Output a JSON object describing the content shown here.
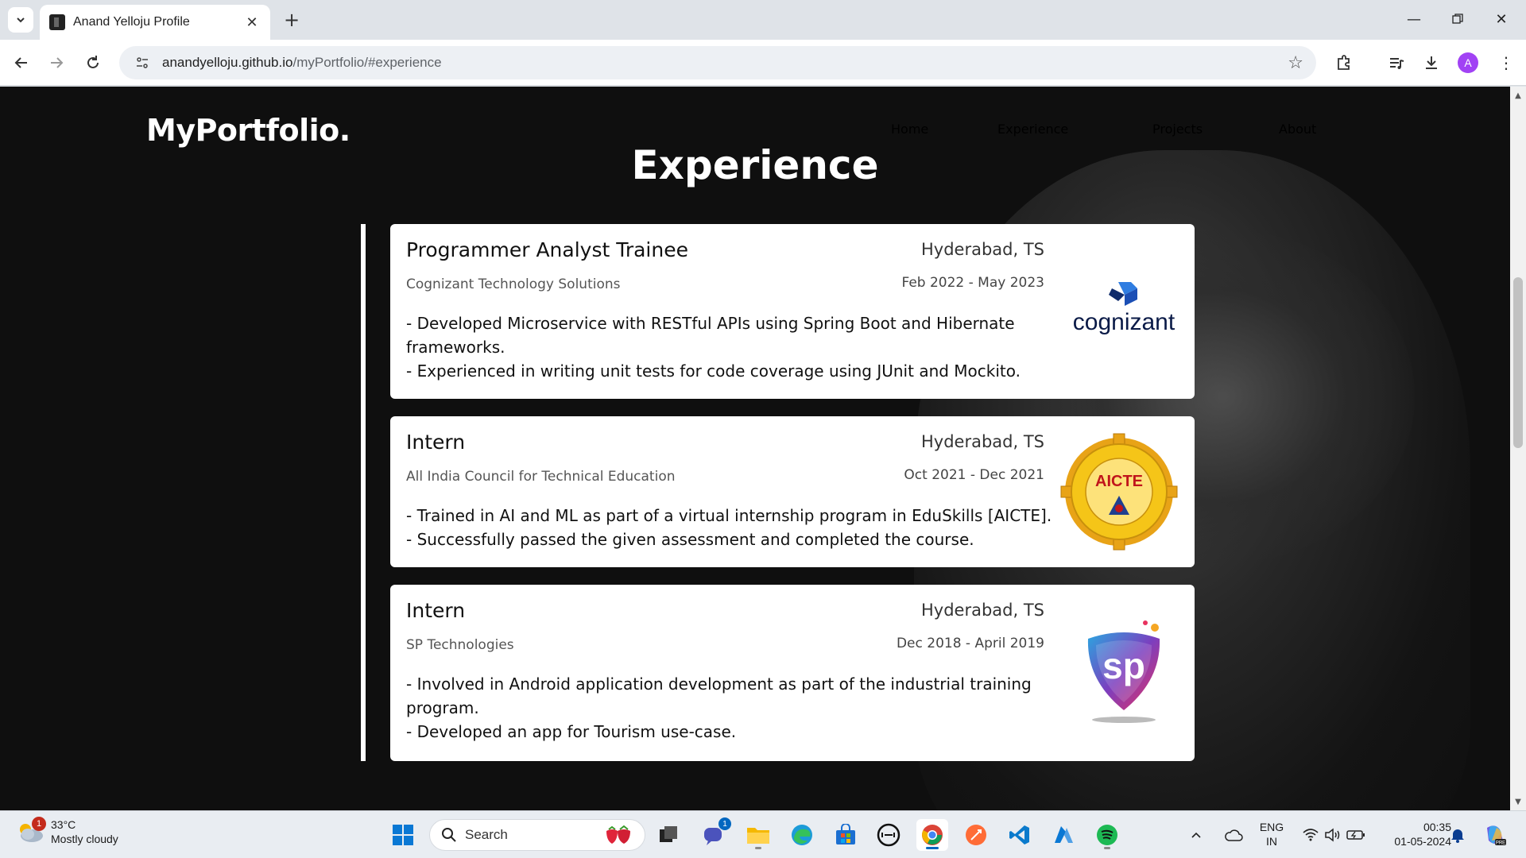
{
  "browser": {
    "tab_title": "Anand Yelloju Profile",
    "url_host": "anandyelloju.github.io",
    "url_path": "/myPortfolio/#experience",
    "profile_initial": "A"
  },
  "site": {
    "logo": "MyPortfolio.",
    "nav": [
      "Home",
      "Experience",
      "Projects",
      "About"
    ],
    "section_title": "Experience"
  },
  "experiences": [
    {
      "role": "Programmer Analyst Trainee",
      "location": "Hyderabad, TS",
      "company": "Cognizant Technology Solutions",
      "dates": "Feb 2022 - May 2023",
      "desc": [
        "- Developed Microservice with RESTful APIs using Spring Boot and Hibernate frameworks.",
        "- Experienced in writing unit tests for code coverage using JUnit and Mockito."
      ],
      "logo": "cognizant"
    },
    {
      "role": "Intern",
      "location": "Hyderabad, TS",
      "company": "All India Council for Technical Education",
      "dates": "Oct 2021 - Dec 2021",
      "desc": [
        "- Trained in AI and ML as part of a virtual internship program in EduSkills [AICTE].",
        "- Successfully passed the given assessment and completed the course."
      ],
      "logo": "AICTE"
    },
    {
      "role": "Intern",
      "location": "Hyderabad, TS",
      "company": "SP Technologies",
      "dates": "Dec 2018 - April 2019",
      "desc": [
        "- Involved in Android application development as part of the industrial training program.",
        "- Developed an app for Tourism use-case."
      ],
      "logo": "sp"
    }
  ],
  "taskbar": {
    "weather_temp": "33°C",
    "weather_desc": "Mostly cloudy",
    "weather_badge": "1",
    "search_placeholder": "Search",
    "chat_badge": "1",
    "lang_line1": "ENG",
    "lang_line2": "IN",
    "time": "00:35",
    "date": "01-05-2024"
  },
  "colors": {
    "page_bg": "#0f0f0f",
    "card_bg": "#ffffff",
    "accent_blue": "#0067c0",
    "profile_purple": "#a142f4"
  }
}
